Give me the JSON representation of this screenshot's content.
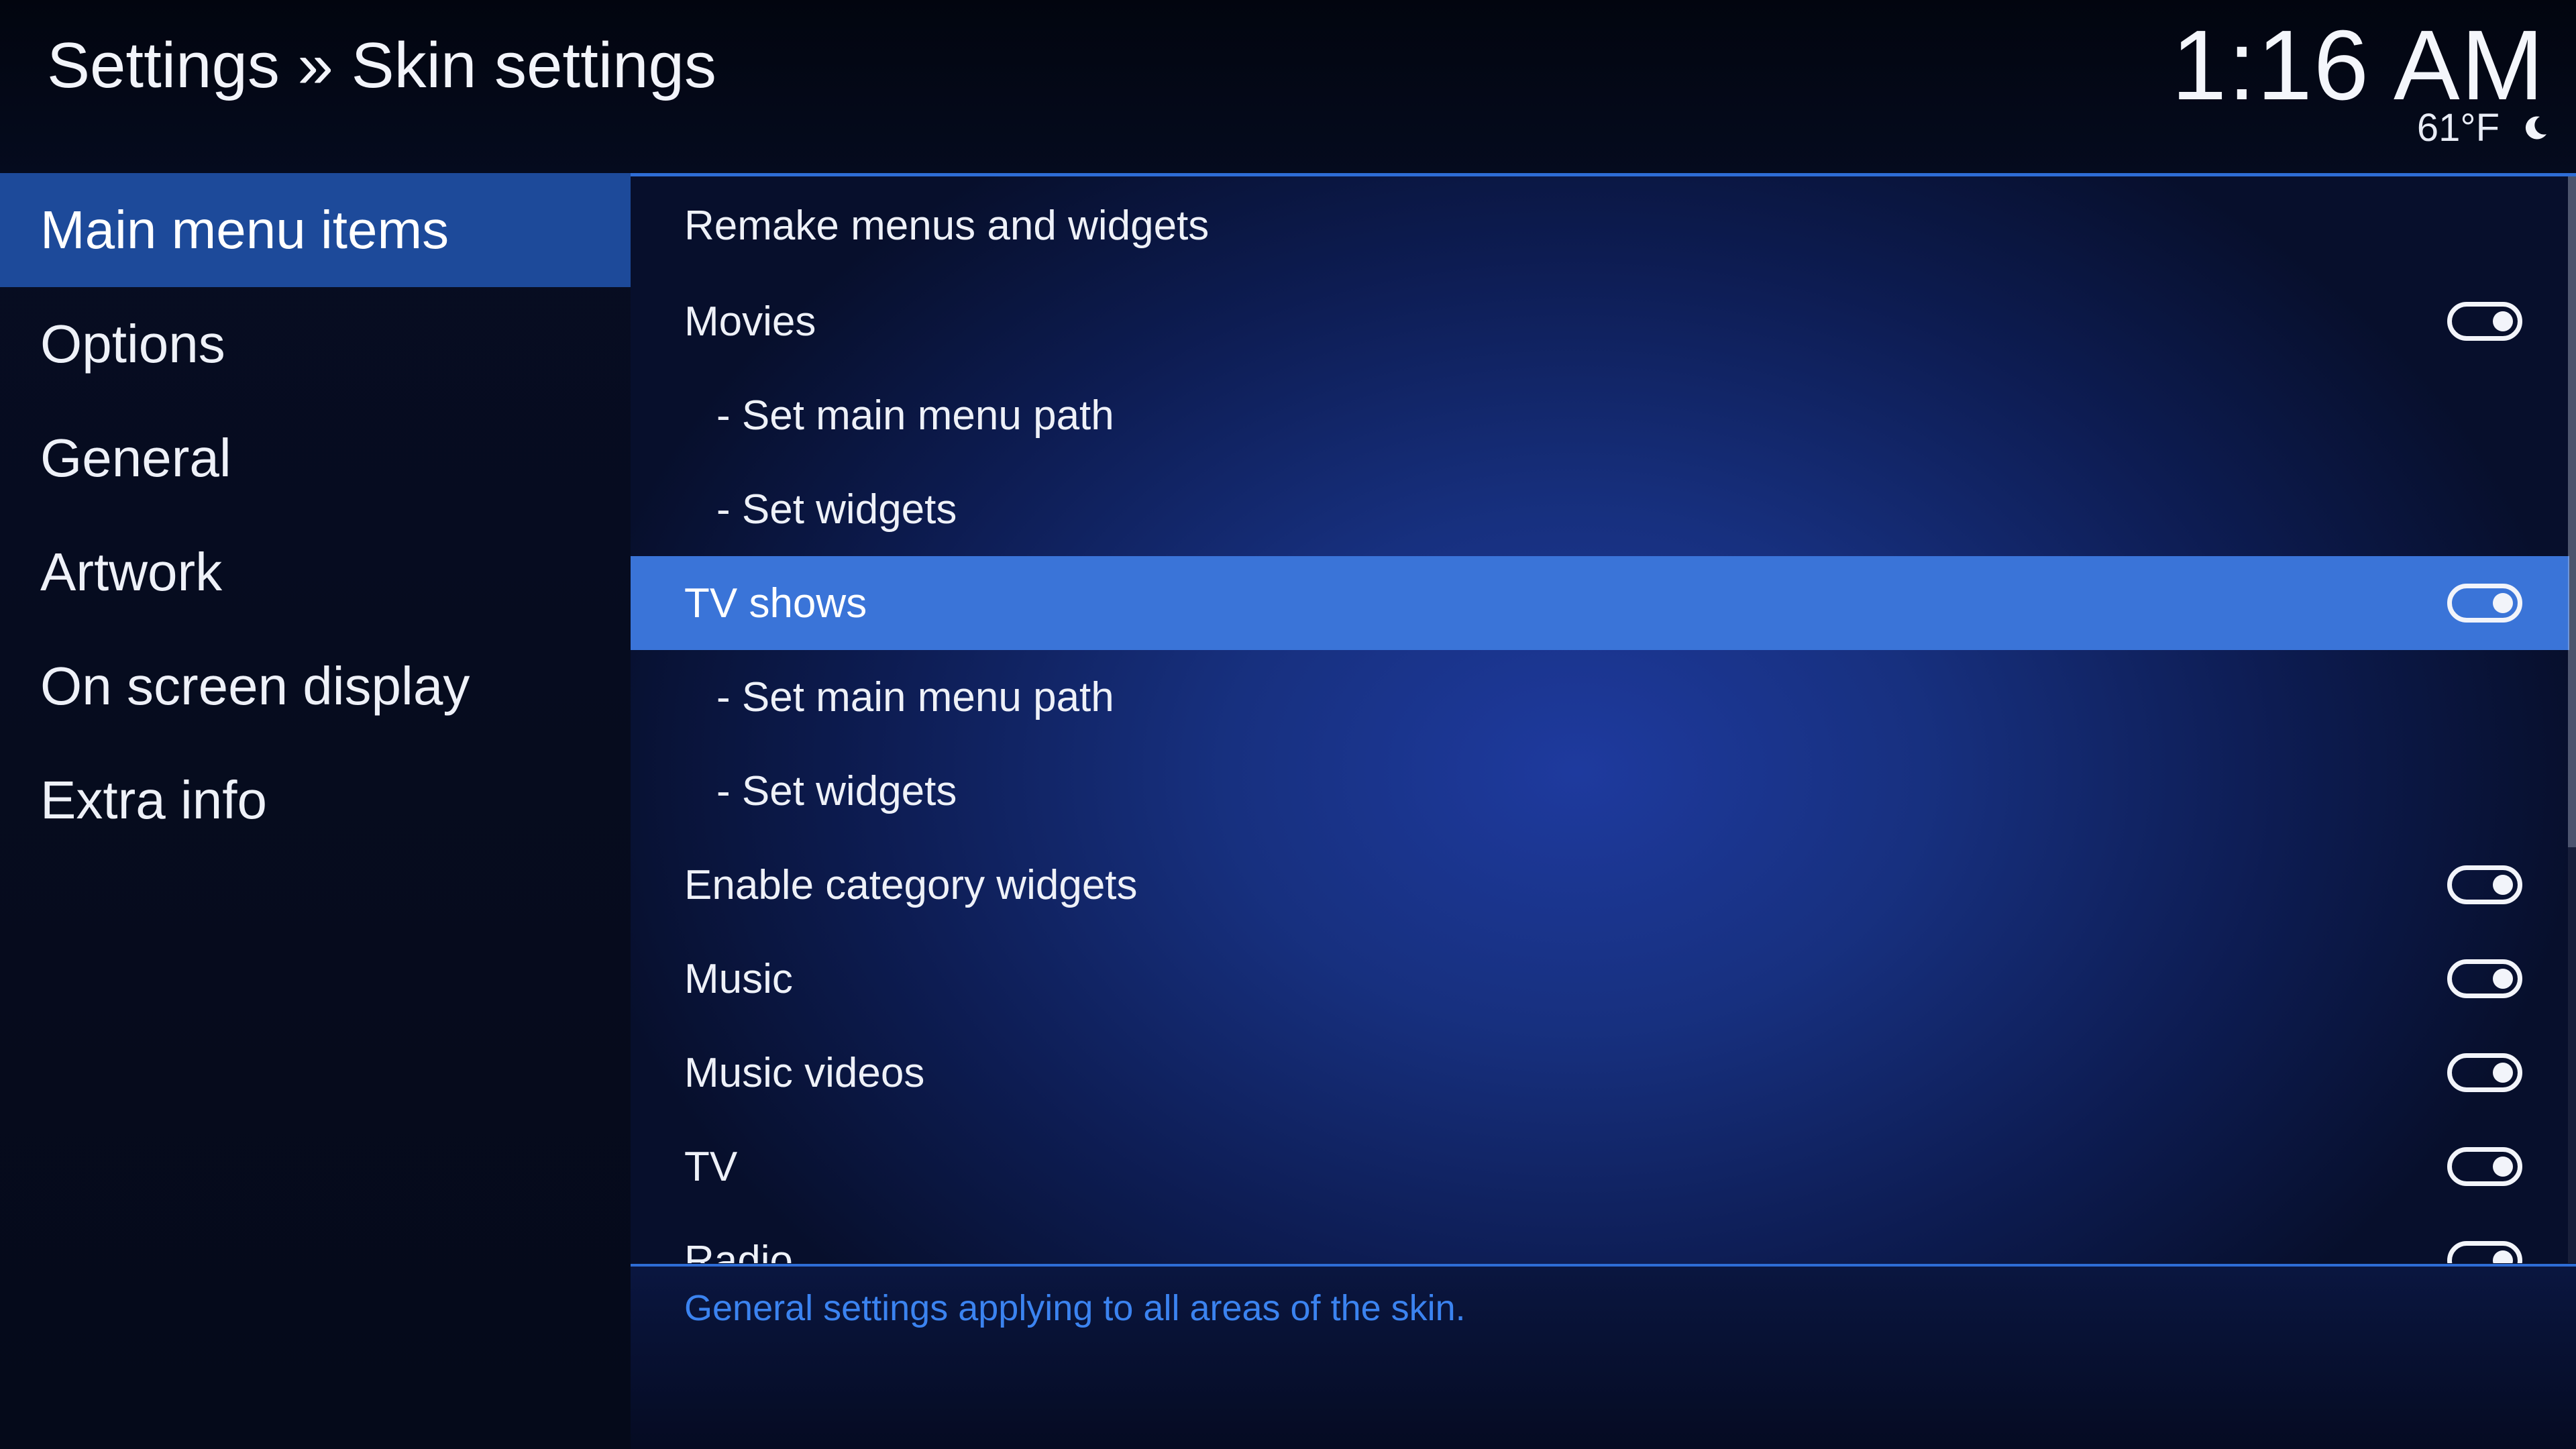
{
  "header": {
    "breadcrumb": "Settings » Skin settings",
    "clock": "1:16 AM",
    "temperature": "61°F",
    "weather_icon": "moon-icon"
  },
  "sidebar": {
    "items": [
      {
        "label": "Main menu items",
        "active": true
      },
      {
        "label": "Options",
        "active": false
      },
      {
        "label": "General",
        "active": false
      },
      {
        "label": "Artwork",
        "active": false
      },
      {
        "label": "On screen display",
        "active": false
      },
      {
        "label": "Extra info",
        "active": false
      }
    ]
  },
  "settings": {
    "rows": [
      {
        "label": "Remake menus and widgets",
        "toggle": null
      },
      {
        "label": "Movies",
        "toggle": "on"
      },
      {
        "label": "- Set main menu path",
        "toggle": null
      },
      {
        "label": "- Set widgets",
        "toggle": null
      },
      {
        "label": "TV shows",
        "toggle": "on",
        "selected": true
      },
      {
        "label": "- Set main menu path",
        "toggle": null
      },
      {
        "label": "- Set widgets",
        "toggle": null
      },
      {
        "label": "Enable category widgets",
        "toggle": "on"
      },
      {
        "label": "Music",
        "toggle": "on"
      },
      {
        "label": "Music videos",
        "toggle": "on"
      },
      {
        "label": "TV",
        "toggle": "on"
      },
      {
        "label": "Radio",
        "toggle": "on"
      }
    ]
  },
  "footer": {
    "description": "General settings applying to all areas of the skin."
  },
  "colors": {
    "accent": "#3a74d8",
    "sidebar_active": "#1d4a9a",
    "description_text": "#3b83f0",
    "divider": "#2e6dd6"
  }
}
